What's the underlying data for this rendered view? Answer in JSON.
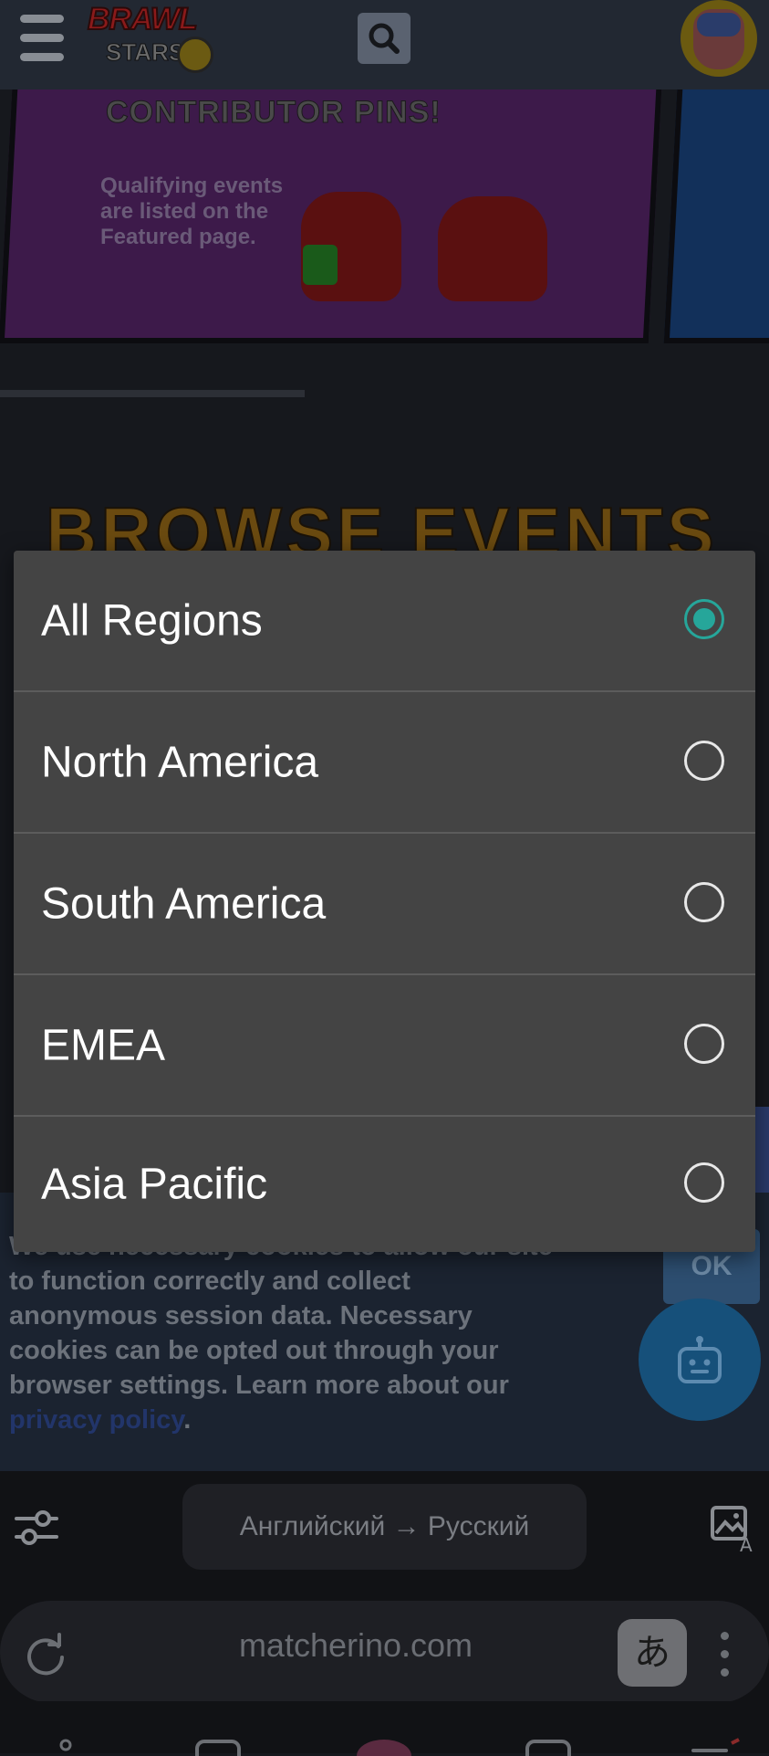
{
  "header": {
    "logo_line1": "BRAWL",
    "logo_line2": "STARS"
  },
  "banner": {
    "title": "CONTRIBUTOR PINS!",
    "subtitle": "Qualifying events are listed on the Featured page."
  },
  "page": {
    "section_title": "BROWSE EVENTS"
  },
  "region_dialog": {
    "options": [
      {
        "label": "All Regions",
        "selected": true
      },
      {
        "label": "North America",
        "selected": false
      },
      {
        "label": "South America",
        "selected": false
      },
      {
        "label": "EMEA",
        "selected": false
      },
      {
        "label": "Asia Pacific",
        "selected": false
      }
    ],
    "accent_color": "#26a69a"
  },
  "cookie_banner": {
    "text": "We use necessary cookies to allow our site to function correctly and collect anonymous session data. Necessary cookies can be opted out through your browser settings. Learn more about our ",
    "link_text": "privacy policy",
    "after_link": ".",
    "ok_label": "OK"
  },
  "translate_bar": {
    "language_pair": "Английский → Русский"
  },
  "address_bar": {
    "url": "matcherino.com",
    "translate_chip": "あ"
  },
  "icons": [
    "menu-icon",
    "search-icon",
    "avatar",
    "bot-icon",
    "settings-sliders-icon",
    "image-translate-icon",
    "reload-icon",
    "more-vert-icon"
  ]
}
